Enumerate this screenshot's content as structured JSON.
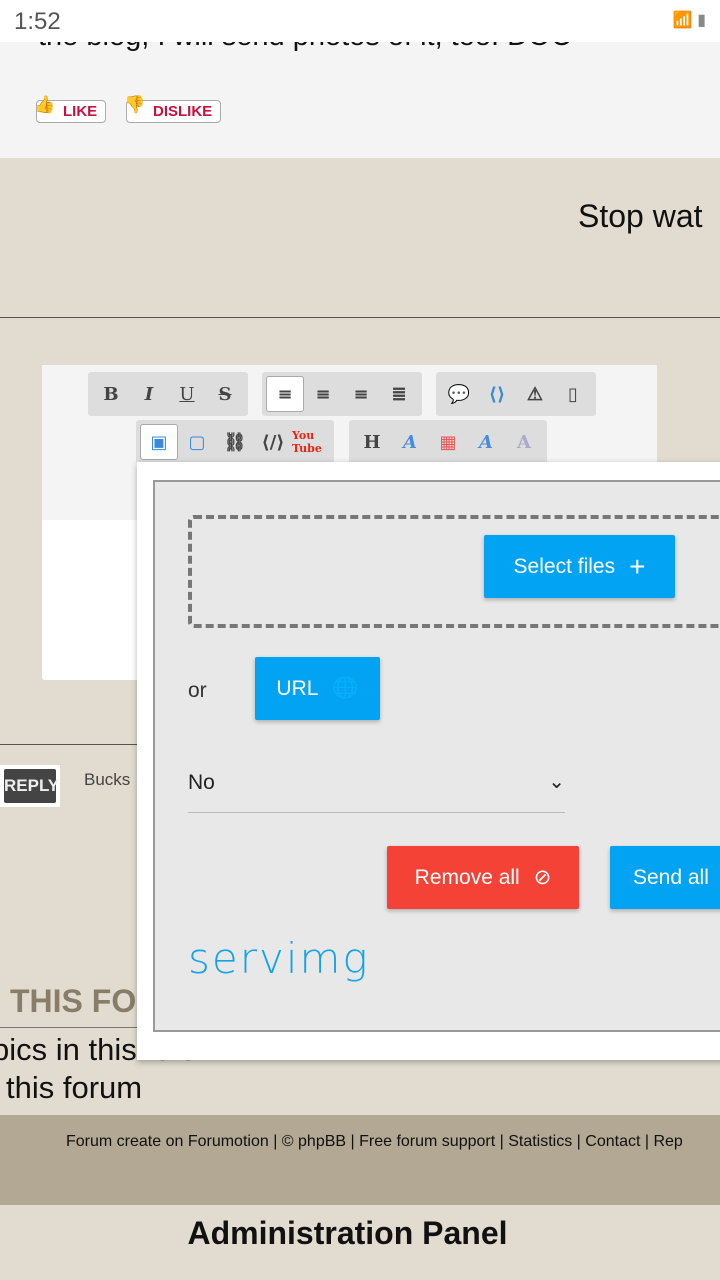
{
  "status_bar": {
    "time": "1:52",
    "icons": [
      "wifi-icon",
      "signal-icon",
      "battery-icon"
    ]
  },
  "post": {
    "text": "the blog, I will send photos of it, too. DOC",
    "like": "LIKE",
    "dislike": "DISLIKE"
  },
  "signature": {
    "text": "Stop wat"
  },
  "editor": {
    "toolbar_row1": [
      "B",
      "I",
      "U",
      "S",
      "align-left",
      "align-center",
      "align-right",
      "justify",
      "quote",
      "code",
      "spoiler",
      "hide"
    ],
    "toolbar_row2": [
      "image-host",
      "insert-image",
      "insert-link",
      "embed",
      "youtube",
      "H",
      "font-size",
      "color",
      "font",
      "remove-format"
    ]
  },
  "reply": {
    "label": "REPLY",
    "bucks": "Bucks"
  },
  "upload_popup": {
    "select_files": "Select files",
    "or": "or",
    "url": "URL",
    "select_value": "No",
    "remove_all": "Remove all",
    "send_all": "Send all",
    "logo": "servimg"
  },
  "permissions": {
    "title": "THIS FO",
    "line1": "pics in this forum",
    "line2": "this forum"
  },
  "footer": {
    "text": "Forum create on Forumotion | © phpBB | Free forum support | Statistics | Contact | Rep"
  },
  "admin_panel": "Administration Panel",
  "colors": {
    "beige": "#e2dcd0",
    "footer": "#b2a893",
    "blue": "#03a3f3",
    "red": "#f44336",
    "like": "#c8103c"
  }
}
